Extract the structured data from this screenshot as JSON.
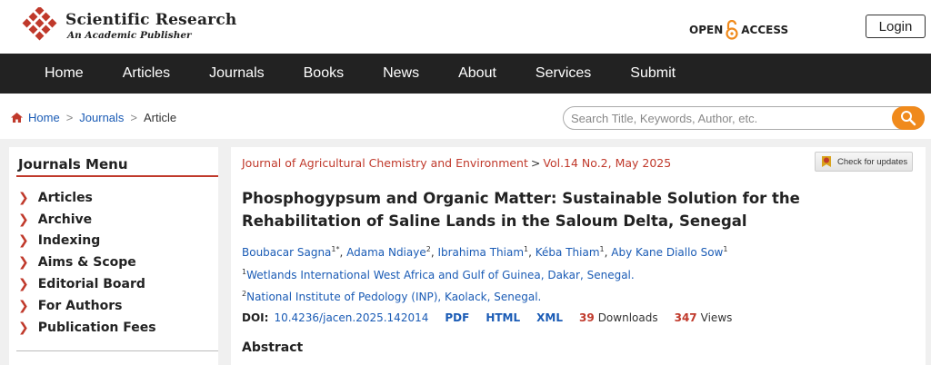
{
  "header": {
    "brand_title": "Scientific Research",
    "brand_subtitle": "An Academic Publisher",
    "open_access_left": "OPEN",
    "open_access_right": "ACCESS",
    "login_label": "Login"
  },
  "nav": {
    "items": [
      "Home",
      "Articles",
      "Journals",
      "Books",
      "News",
      "About",
      "Services",
      "Submit"
    ]
  },
  "breadcrumb": {
    "home": "Home",
    "journals": "Journals",
    "current": "Article"
  },
  "search": {
    "placeholder": "Search Title, Keywords, Author, etc."
  },
  "sidebar": {
    "title": "Journals Menu",
    "items": [
      "Articles",
      "Archive",
      "Indexing",
      "Aims & Scope",
      "Editorial Board",
      "For Authors",
      "Publication Fees"
    ]
  },
  "article": {
    "journal": "Journal of Agricultural Chemistry and Environment",
    "volume": "Vol.14 No.2, May 2025",
    "check_updates": "Check for updates",
    "title": "Phosphogypsum and Organic Matter: Sustainable Solution for the Rehabilitation of Saline Lands in the Saloum Delta, Senegal",
    "authors": [
      {
        "name": "Boubacar Sagna",
        "sup": "1*"
      },
      {
        "name": "Adama Ndiaye",
        "sup": "2"
      },
      {
        "name": "Ibrahima Thiam",
        "sup": "1"
      },
      {
        "name": "Kéba Thiam",
        "sup": "1"
      },
      {
        "name": "Aby Kane Diallo Sow",
        "sup": "1"
      }
    ],
    "affiliations": [
      {
        "sup": "1",
        "text": "Wetlands International West Africa and Gulf of Guinea, Dakar, Senegal."
      },
      {
        "sup": "2",
        "text": "National Institute of Pedology (INP), Kaolack, Senegal."
      }
    ],
    "doi_label": "DOI:",
    "doi": "10.4236/jacen.2025.142014",
    "formats": [
      "PDF",
      "HTML",
      "XML"
    ],
    "downloads": "39",
    "downloads_label": "Downloads",
    "views": "347",
    "views_label": "Views",
    "abstract_heading": "Abstract"
  },
  "colors": {
    "accent_red": "#c0392b",
    "link_blue": "#1a5bb5",
    "nav_bg": "#222222",
    "search_orange": "#f08a1c"
  }
}
